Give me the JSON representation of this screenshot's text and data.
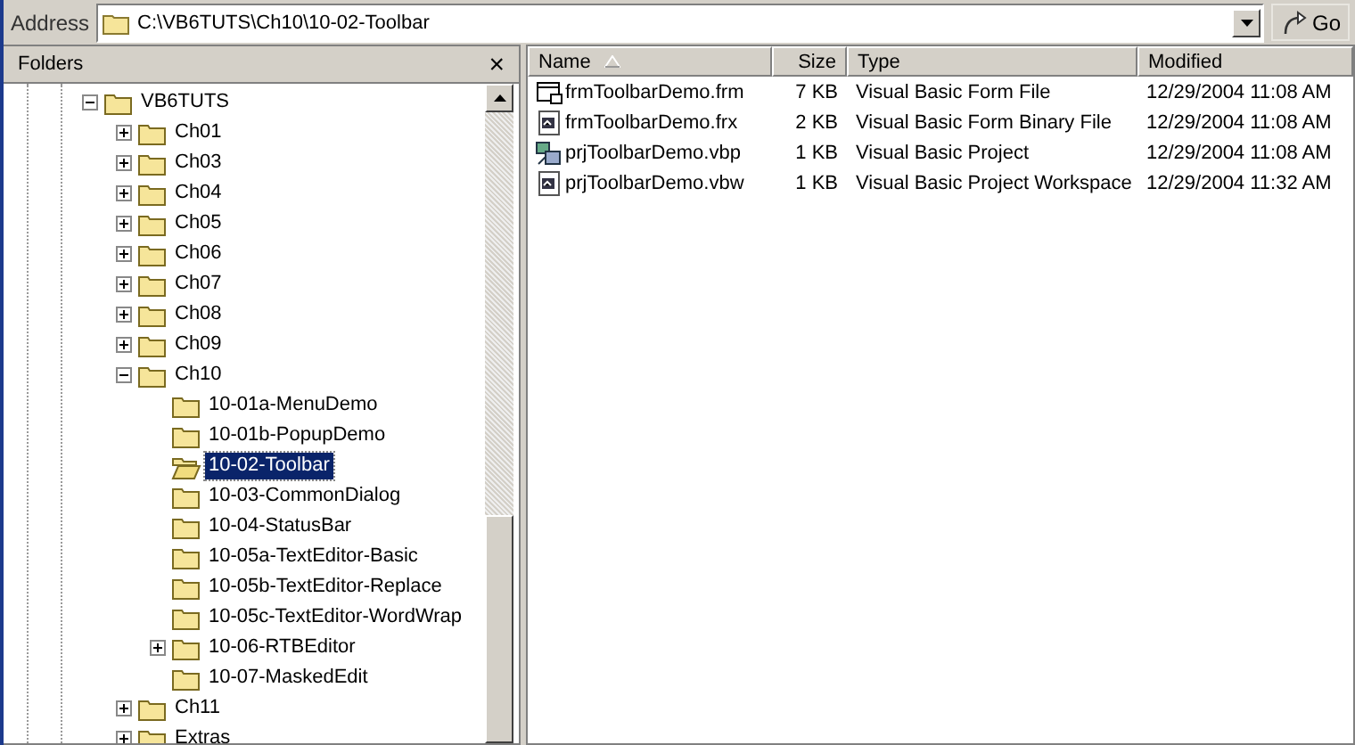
{
  "address_bar": {
    "label": "Address",
    "value": "C:\\VB6TUTS\\Ch10\\10-02-Toolbar",
    "go_label": "Go"
  },
  "folders_pane": {
    "title": "Folders",
    "close": "×",
    "tree": [
      {
        "label": "VB6TUTS",
        "expanded": true,
        "selected": false,
        "children": [
          {
            "label": "Ch01",
            "expanded": false,
            "selected": false
          },
          {
            "label": "Ch03",
            "expanded": false,
            "selected": false
          },
          {
            "label": "Ch04",
            "expanded": false,
            "selected": false
          },
          {
            "label": "Ch05",
            "expanded": false,
            "selected": false
          },
          {
            "label": "Ch06",
            "expanded": false,
            "selected": false
          },
          {
            "label": "Ch07",
            "expanded": false,
            "selected": false
          },
          {
            "label": "Ch08",
            "expanded": false,
            "selected": false
          },
          {
            "label": "Ch09",
            "expanded": false,
            "selected": false
          },
          {
            "label": "Ch10",
            "expanded": true,
            "selected": false,
            "children": [
              {
                "label": "10-01a-MenuDemo",
                "selected": false
              },
              {
                "label": "10-01b-PopupDemo",
                "selected": false
              },
              {
                "label": "10-02-Toolbar",
                "selected": true
              },
              {
                "label": "10-03-CommonDialog",
                "selected": false
              },
              {
                "label": "10-04-StatusBar",
                "selected": false
              },
              {
                "label": "10-05a-TextEditor-Basic",
                "selected": false
              },
              {
                "label": "10-05b-TextEditor-Replace",
                "selected": false
              },
              {
                "label": "10-05c-TextEditor-WordWrap",
                "selected": false
              },
              {
                "label": "10-06-RTBEditor",
                "expanded": false,
                "selected": false
              },
              {
                "label": "10-07-MaskedEdit",
                "selected": false
              }
            ]
          },
          {
            "label": "Ch11",
            "expanded": false,
            "selected": false
          },
          {
            "label": "Extras",
            "expanded": false,
            "selected": false
          }
        ]
      }
    ]
  },
  "file_list": {
    "columns": [
      {
        "label": "Name",
        "sorted": true
      },
      {
        "label": "Size",
        "sorted": false
      },
      {
        "label": "Type",
        "sorted": false
      },
      {
        "label": "Modified",
        "sorted": false
      }
    ],
    "rows": [
      {
        "kind": "form",
        "name": "frmToolbarDemo.frm",
        "size": "7 KB",
        "type": "Visual Basic Form File",
        "modified": "12/29/2004 11:08 AM"
      },
      {
        "kind": "binary",
        "name": "frmToolbarDemo.frx",
        "size": "2 KB",
        "type": "Visual Basic Form Binary File",
        "modified": "12/29/2004 11:08 AM"
      },
      {
        "kind": "project",
        "name": "prjToolbarDemo.vbp",
        "size": "1 KB",
        "type": "Visual Basic Project",
        "modified": "12/29/2004 11:08 AM"
      },
      {
        "kind": "binary",
        "name": "prjToolbarDemo.vbw",
        "size": "1 KB",
        "type": "Visual Basic Project Workspace",
        "modified": "12/29/2004 11:32 AM"
      }
    ]
  }
}
